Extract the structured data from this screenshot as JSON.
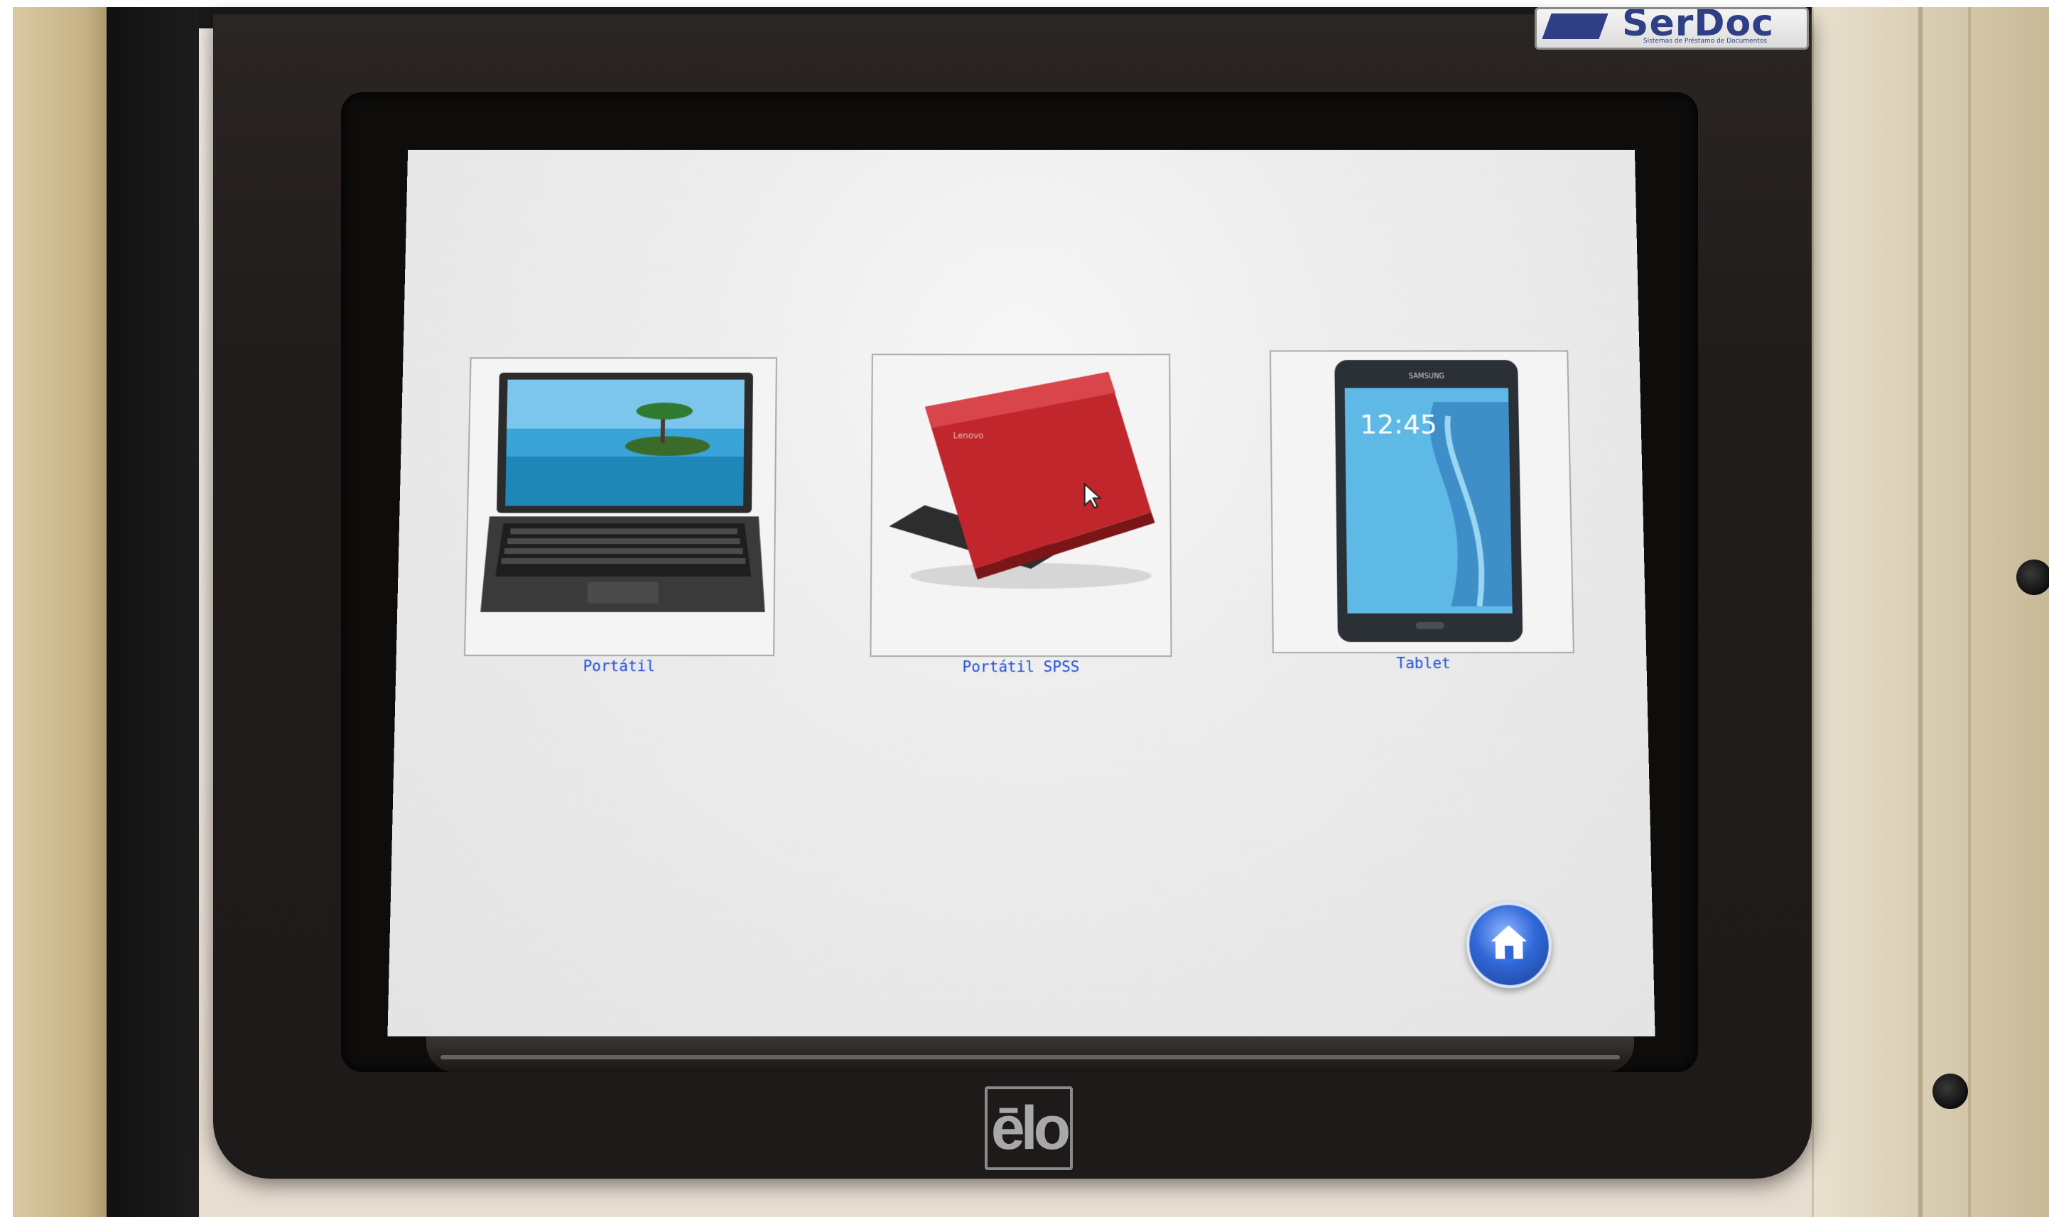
{
  "kiosk": {
    "bezel_logo": "ēlo",
    "badge_logo": "SerDoc",
    "badge_subtitle": "Sistemas de Préstamo de Documentos"
  },
  "screen": {
    "tiles": [
      {
        "label": "Portátil",
        "icon": "black-laptop-image"
      },
      {
        "label": "Portátil SPSS",
        "icon": "red-laptop-image"
      },
      {
        "label": "Tablet",
        "icon": "samsung-tablet-image"
      }
    ],
    "tablet_time": "12:45",
    "tablet_brand": "SAMSUNG",
    "home_button": {
      "icon": "home-icon"
    }
  },
  "colors": {
    "label_blue": "#1e4fd6",
    "screen_bg": "#ececec",
    "bezel": "#211d1c",
    "red_laptop": "#c0262b",
    "home_blue": "#3168d8"
  }
}
